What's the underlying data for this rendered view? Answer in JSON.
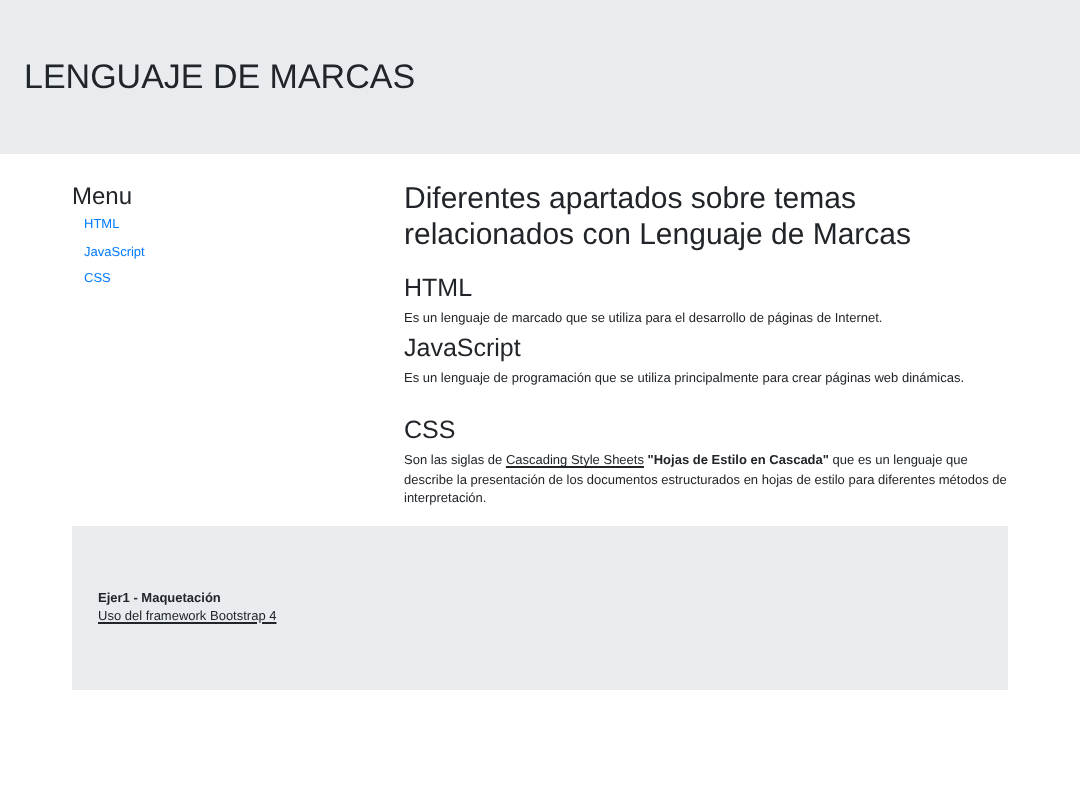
{
  "header": {
    "title": "LENGUAJE DE MARCAS"
  },
  "menu": {
    "title": "Menu",
    "items": [
      "HTML",
      "JavaScript",
      "CSS"
    ]
  },
  "main": {
    "title": "Diferentes apartados sobre temas relacionados con Lenguaje de Marcas",
    "sections": [
      {
        "heading": "HTML",
        "text": "Es un lenguaje de marcado que se utiliza para el desarrollo de páginas de Internet."
      },
      {
        "heading": "JavaScript",
        "text": "Es un lenguaje de programación que se utiliza principalmente para crear páginas web dinámicas."
      },
      {
        "heading": "CSS",
        "text": "Son las siglas de ",
        "link": "Cascading Style Sheets",
        "text_after": " **\"Hojas de Estilo en Cascada\"** que es un lenguaje que describe la presentación de los documentos estructurados en hojas de estilo para diferentes métodos de interpretación."
      }
    ]
  },
  "footer": {
    "title": "Ejer1 - Maquetación",
    "link": "Uso del framework Bootstrap 4"
  }
}
